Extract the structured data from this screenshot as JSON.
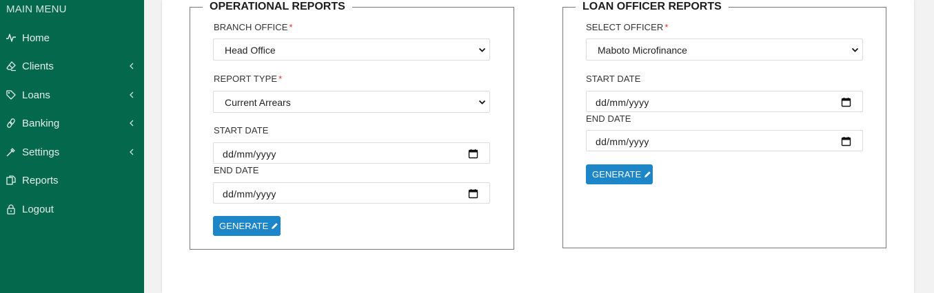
{
  "sidebar": {
    "header": "MAIN MENU",
    "items": [
      {
        "label": "Home",
        "icon": "pulse-icon",
        "has_submenu": false
      },
      {
        "label": "Clients",
        "icon": "eraser-icon",
        "has_submenu": true
      },
      {
        "label": "Loans",
        "icon": "tags-icon",
        "has_submenu": true
      },
      {
        "label": "Banking",
        "icon": "link-icon",
        "has_submenu": true
      },
      {
        "label": "Settings",
        "icon": "wand-icon",
        "has_submenu": true
      },
      {
        "label": "Reports",
        "icon": "copy-icon",
        "has_submenu": false
      },
      {
        "label": "Logout",
        "icon": "lock-icon",
        "has_submenu": false
      }
    ],
    "bg_color": "#04684d"
  },
  "operational": {
    "title": "OPERATIONAL REPORTS",
    "branch_label": "BRANCH OFFICE",
    "branch_value": "Head Office",
    "report_type_label": "REPORT TYPE",
    "report_type_value": "Current Arrears",
    "start_label": "START DATE",
    "start_placeholder": "dd/mm/yyyy",
    "end_label": "END DATE",
    "end_placeholder": "dd/mm/yyyy",
    "generate_label": "GENERATE"
  },
  "loan_officer": {
    "title": "LOAN OFFICER REPORTS",
    "officer_label": "SELECT OFFICER",
    "officer_value": "Maboto Microfinance",
    "start_label": "START DATE",
    "start_placeholder": "dd/mm/yyyy",
    "end_label": "END DATE",
    "end_placeholder": "dd/mm/yyyy",
    "generate_label": "GENERATE"
  },
  "required_marker": "*",
  "accent_color": "#1d86c9"
}
